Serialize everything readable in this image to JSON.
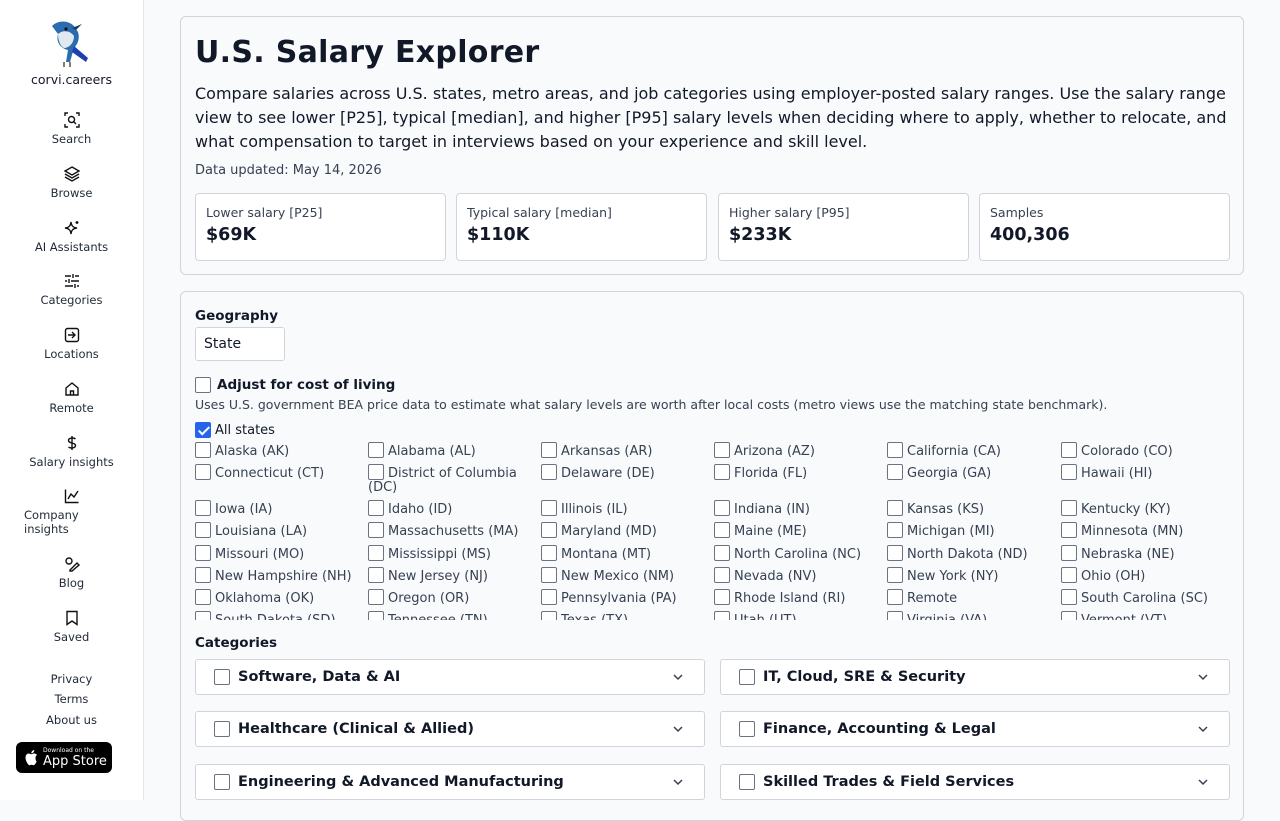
{
  "brand": "corvi.careers",
  "nav": [
    {
      "label": "Search",
      "icon": "search-icon"
    },
    {
      "label": "Browse",
      "icon": "layers-icon"
    },
    {
      "label": "AI Assistants",
      "icon": "sparkle-icon"
    },
    {
      "label": "Categories",
      "icon": "sliders-icon"
    },
    {
      "label": "Locations",
      "icon": "enter-icon"
    },
    {
      "label": "Remote",
      "icon": "home-icon"
    },
    {
      "label": "Salary insights",
      "icon": "dollar-icon"
    },
    {
      "label": "Company insights",
      "icon": "chart-icon"
    },
    {
      "label": "Blog",
      "icon": "pen-icon"
    },
    {
      "label": "Saved",
      "icon": "bookmark-icon"
    }
  ],
  "footer": {
    "privacy": "Privacy",
    "terms": "Terms",
    "about": "About us"
  },
  "appstore": {
    "small": "Download on the",
    "big": "App Store"
  },
  "header": {
    "title": "U.S. Salary Explorer",
    "description": "Compare salaries across U.S. states, metro areas, and job categories using employer-posted salary ranges. Use the salary range view to see lower [P25], typical [median], and higher [P95] salary levels when deciding where to apply, whether to relocate, and what compensation to target in interviews based on your experience and skill level.",
    "updated": "Data updated: May 14, 2026"
  },
  "stats": [
    {
      "label": "Lower salary [P25]",
      "value": "$69K"
    },
    {
      "label": "Typical salary [median]",
      "value": "$110K"
    },
    {
      "label": "Higher salary [P95]",
      "value": "$233K"
    },
    {
      "label": "Samples",
      "value": "400,306"
    }
  ],
  "filters": {
    "geography_label": "Geography",
    "geography_value": "State",
    "col_label": "Adjust for cost of living",
    "col_checked": false,
    "col_note": "Uses U.S. government BEA price data to estimate what salary levels are worth after local costs (metro views use the matching state benchmark).",
    "all_states_label": "All states",
    "all_states_checked": true,
    "states": [
      "Alaska (AK)",
      "Alabama (AL)",
      "Arkansas (AR)",
      "Arizona (AZ)",
      "California (CA)",
      "Colorado (CO)",
      "Connecticut (CT)",
      "District of Columbia (DC)",
      "Delaware (DE)",
      "Florida (FL)",
      "Georgia (GA)",
      "Hawaii (HI)",
      "Iowa (IA)",
      "Idaho (ID)",
      "Illinois (IL)",
      "Indiana (IN)",
      "Kansas (KS)",
      "Kentucky (KY)",
      "Louisiana (LA)",
      "Massachusetts (MA)",
      "Maryland (MD)",
      "Maine (ME)",
      "Michigan (MI)",
      "Minnesota (MN)",
      "Missouri (MO)",
      "Mississippi (MS)",
      "Montana (MT)",
      "North Carolina (NC)",
      "North Dakota (ND)",
      "Nebraska (NE)",
      "New Hampshire (NH)",
      "New Jersey (NJ)",
      "New Mexico (NM)",
      "Nevada (NV)",
      "New York (NY)",
      "Ohio (OH)",
      "Oklahoma (OK)",
      "Oregon (OR)",
      "Pennsylvania (PA)",
      "Rhode Island (RI)",
      "Remote",
      "South Carolina (SC)",
      "South Dakota (SD)",
      "Tennessee (TN)",
      "Texas (TX)",
      "Utah (UT)",
      "Virginia (VA)",
      "Vermont (VT)"
    ],
    "categories_label": "Categories",
    "categories": [
      "Software, Data & AI",
      "IT, Cloud, SRE & Security",
      "Healthcare (Clinical & Allied)",
      "Finance, Accounting & Legal",
      "Engineering & Advanced Manufacturing",
      "Skilled Trades & Field Services"
    ]
  },
  "colors": {
    "accent": "#2563eb",
    "border": "#d1d5db",
    "background": "#f8fafc"
  }
}
